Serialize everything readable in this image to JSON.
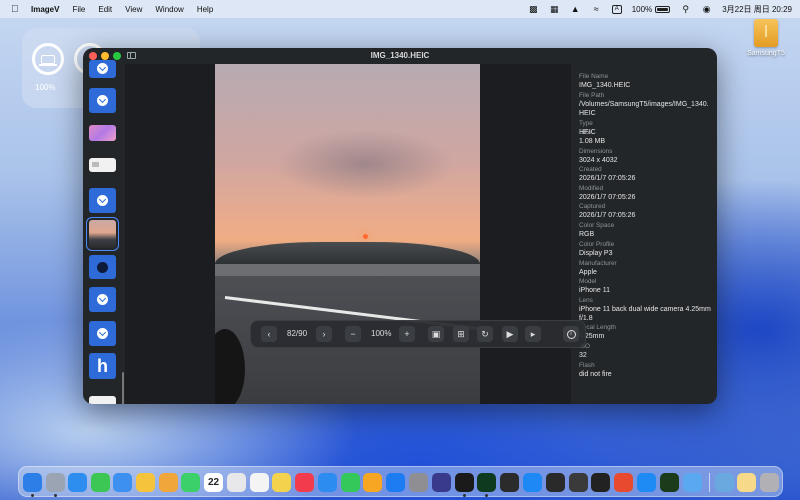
{
  "menubar": {
    "app_name": "ImageV",
    "menus": [
      "File",
      "Edit",
      "View",
      "Window",
      "Help"
    ],
    "input_method": "A",
    "battery_percent": "100%",
    "datetime": "3月22日 周日  20:29"
  },
  "battery_widget": {
    "items": [
      {
        "label": "100%",
        "level": 1.0
      },
      {
        "label": "9",
        "level": 1.0
      }
    ]
  },
  "desktop": {
    "drive_label": "SamsungT5"
  },
  "window": {
    "title": "IMG_1340.HEIC",
    "toolbar": {
      "prev": "‹",
      "counter": "82/90",
      "next": "›",
      "zoom_out": "−",
      "zoom_level": "100%",
      "zoom_in": "+"
    },
    "info": [
      {
        "key": "File Name",
        "value": "IMG_1340.HEIC"
      },
      {
        "key": "File Path",
        "value": "/Volumes/SamsungT5/images/IMG_1340.HEIC"
      },
      {
        "key": "Type",
        "value": "HEIC"
      },
      {
        "key": "Size",
        "value": "1.08 MB"
      },
      {
        "key": "Dimensions",
        "value": "3024 x 4032"
      },
      {
        "key": "Created",
        "value": "2026/1/7 07:05:26"
      },
      {
        "key": "Modified",
        "value": "2026/1/7 07:05:26"
      },
      {
        "key": "Captured",
        "value": "2026/1/7 07:05:26"
      },
      {
        "key": "Color Space",
        "value": "RGB"
      },
      {
        "key": "Color Profile",
        "value": "Display P3"
      },
      {
        "key": "Manufacturer",
        "value": "Apple"
      },
      {
        "key": "Model",
        "value": "iPhone 11"
      },
      {
        "key": "Lens",
        "value": "iPhone 11 back dual wide camera 4.25mm f/1.8"
      },
      {
        "key": "Focal Length",
        "value": "4.25mm"
      },
      {
        "key": "ISO",
        "value": "32"
      },
      {
        "key": "Flash",
        "value": "did not fire"
      }
    ]
  },
  "dock": {
    "calendar_day": "22",
    "colors": [
      "#2b7fe6",
      "#9aa4b2",
      "#2e8ef0",
      "#3cc654",
      "#3d8ff0",
      "#f5c43a",
      "#f0a63a",
      "#3bd06a",
      "#a7a7ab",
      "#e8e8ea",
      "#f4f4f4",
      "#f3d34e",
      "#f33b4e",
      "#2d8cf0",
      "#34c759",
      "#f6a623",
      "#1d7cf2",
      "#8e8e93",
      "#3a3a8c",
      "#1a1a1a",
      "#0e3b1f",
      "#2b2b2b",
      "#1e88f5",
      "#2a2a2a",
      "#3a3a3a",
      "#222",
      "#e84a2f",
      "#1d8bf3",
      "#1b3b1b",
      "#5aa9f0",
      "#6aa8e0",
      "#f7d98a",
      "#b0b0b5"
    ]
  }
}
